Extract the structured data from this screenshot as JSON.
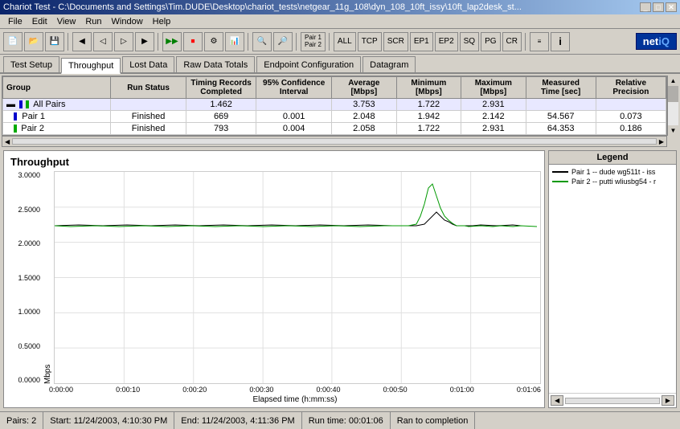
{
  "window": {
    "title": "Chariot Test - C:\\Documents and Settings\\Tim.DUDE\\Desktop\\chariot_tests\\netgear_11g_108\\dyn_108_10ft_issy\\10ft_lap2desk_st..."
  },
  "menu": {
    "items": [
      "File",
      "Edit",
      "View",
      "Run",
      "Window",
      "Help"
    ]
  },
  "toolbar": {
    "buttons": [
      "new",
      "open",
      "save",
      "cut",
      "copy",
      "paste",
      "undo",
      "redo",
      "run",
      "stop",
      "pair1pair2",
      "ALL",
      "TCP",
      "SCR",
      "EP1",
      "EP2",
      "SQ",
      "PG",
      "CR"
    ],
    "pair_label": "Pair 1\nPair 2",
    "all_label": "ALL",
    "tcp_label": "TCP",
    "scr_label": "SCR",
    "ep1_label": "EP1",
    "ep2_label": "EP2",
    "sq_label": "SQ",
    "pg_label": "PG",
    "cr_label": "CR"
  },
  "tabs": {
    "items": [
      "Test Setup",
      "Throughput",
      "Lost Data",
      "Raw Data Totals",
      "Endpoint Configuration",
      "Datagram"
    ],
    "active": "Throughput"
  },
  "table": {
    "headers": [
      "Group",
      "Run Status",
      "Timing Records\nCompleted",
      "95% Confidence\nInterval",
      "Average\n[Mbps]",
      "Minimum\n[Mbps]",
      "Maximum\n[Mbps]",
      "Measured\nTime [sec]",
      "Relative\nPrecision"
    ],
    "rows": [
      {
        "type": "group",
        "icon": "group",
        "name": "All Pairs",
        "run_status": "",
        "timing_records": "1.462",
        "confidence": "",
        "average": "3.753",
        "minimum": "1.722",
        "maximum": "2.931",
        "measured_time": "",
        "relative_precision": ""
      },
      {
        "type": "pair",
        "icon": "pair1",
        "name": "Pair 1",
        "run_status": "Finished",
        "timing_records": "669",
        "confidence": "0.001",
        "average": "2.048",
        "minimum": "1.942",
        "maximum": "2.142",
        "measured_time": "54.567",
        "relative_precision": "0.073"
      },
      {
        "type": "pair",
        "icon": "pair2",
        "name": "Pair 2",
        "run_status": "Finished",
        "timing_records": "793",
        "confidence": "0.004",
        "average": "2.058",
        "minimum": "1.722",
        "maximum": "2.931",
        "measured_time": "64.353",
        "relative_precision": "0.186"
      }
    ]
  },
  "chart": {
    "title": "Throughput",
    "y_axis": {
      "label": "Mbps",
      "values": [
        "3.0000",
        "2.5000",
        "2.0000",
        "1.5000",
        "1.0000",
        "0.5000",
        "0.0000"
      ]
    },
    "x_axis": {
      "label": "Elapsed time (h:mm:ss)",
      "values": [
        "0:00:00",
        "0:00:10",
        "0:00:20",
        "0:00:30",
        "0:00:40",
        "0:00:50",
        "0:01:00",
        "0:01:06"
      ]
    }
  },
  "legend": {
    "title": "Legend",
    "items": [
      {
        "color": "#000000",
        "label": "Pair 1 -- dude wg511t - iss"
      },
      {
        "color": "#009900",
        "label": "Pair 2 -- putti wliusbg54 - r"
      }
    ]
  },
  "statusbar": {
    "pairs": "Pairs: 2",
    "start": "Start: 11/24/2003, 4:10:30 PM",
    "end": "End: 11/24/2003, 4:11:36 PM",
    "runtime": "Run time: 00:01:06",
    "status": "Ran to completion"
  }
}
